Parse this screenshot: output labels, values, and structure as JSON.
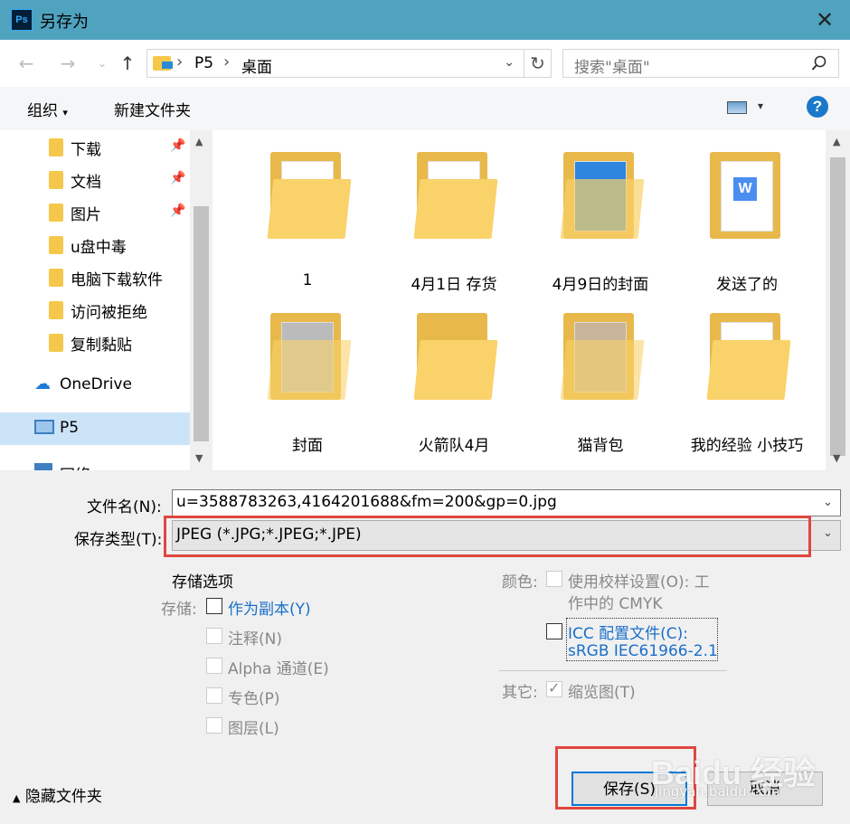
{
  "window": {
    "title": "另存为",
    "app_icon": "Ps"
  },
  "nav": {
    "breadcrumbs": [
      "P5",
      "桌面"
    ],
    "search_placeholder": "搜索\"桌面\""
  },
  "toolbar": {
    "organize": "组织",
    "new_folder": "新建文件夹"
  },
  "sidebar": {
    "items": [
      {
        "label": "下载",
        "pinned": true
      },
      {
        "label": "文档",
        "pinned": true
      },
      {
        "label": "图片",
        "pinned": true
      },
      {
        "label": "u盘中毒"
      },
      {
        "label": "电脑下载软件"
      },
      {
        "label": "访问被拒绝"
      },
      {
        "label": "复制黏贴"
      },
      {
        "label": "OneDrive"
      },
      {
        "label": "P5",
        "selected": true
      },
      {
        "label": "网络"
      }
    ]
  },
  "files": [
    {
      "name": "1"
    },
    {
      "name": "4月1日 存货"
    },
    {
      "name": "4月9日的封面"
    },
    {
      "name": "发送了的"
    },
    {
      "name": "封面"
    },
    {
      "name": "火箭队4月"
    },
    {
      "name": "猫背包"
    },
    {
      "name": "我的经验  小技巧"
    }
  ],
  "form": {
    "filename_label": "文件名(N):",
    "filename_value": "u=3588783263,4164201688&fm=200&gp=0.jpg",
    "type_label": "保存类型(T):",
    "type_value": "JPEG (*.JPG;*.JPEG;*.JPE)"
  },
  "options": {
    "heading": "存储选项",
    "storage_label": "存储:",
    "as_copy": "作为副本(Y)",
    "notes": "注释(N)",
    "alpha": "Alpha 通道(E)",
    "spot": "专色(P)",
    "layers": "图层(L)",
    "color_label": "颜色:",
    "proof_line1": "使用校样设置(O):  工",
    "proof_line2": "作中的 CMYK",
    "icc_line1": "ICC 配置文件(C):",
    "icc_line2": "sRGB IEC61966-2.1",
    "other_label": "其它:",
    "thumbnail": "缩览图(T)"
  },
  "footer": {
    "hide_folders": "隐藏文件夹",
    "save": "保存(S)",
    "cancel": "取消"
  },
  "watermark": {
    "brand": "Baidu 经验",
    "url": "jingyan.baidu.com"
  },
  "colors": {
    "titlebar": "#4fa3bf",
    "highlight_box": "#e0463f",
    "accent": "#0078d7"
  }
}
